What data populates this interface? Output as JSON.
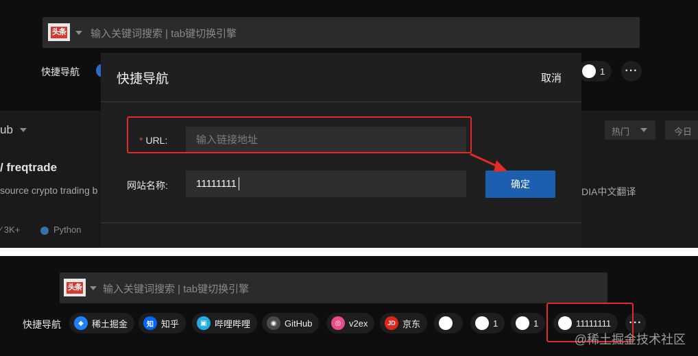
{
  "search": {
    "engine_logo": "头条",
    "placeholder": "输入关键词搜索 | tab键切换引擎"
  },
  "quick_nav": {
    "label": "快捷导航",
    "top_partial_count": "1",
    "items": [
      {
        "label": "稀土掘金",
        "icon": "juejin-icon",
        "color": "#1e80ff",
        "glyph": "◆"
      },
      {
        "label": "知乎",
        "icon": "zhihu-icon",
        "color": "#0066ff",
        "glyph": "知"
      },
      {
        "label": "哔哩哔哩",
        "icon": "bilibili-icon",
        "color": "#23ade5",
        "glyph": "▣"
      },
      {
        "label": "GitHub",
        "icon": "github-icon",
        "color": "#333333",
        "glyph": "◉"
      },
      {
        "label": "v2ex",
        "icon": "v2ex-icon",
        "color": "#ea4c89",
        "glyph": "◎"
      },
      {
        "label": "京东",
        "icon": "jd-icon",
        "color": "#e1251b",
        "glyph": "JD"
      },
      {
        "label": "",
        "icon": "blank-site-icon",
        "color": "#ffffff",
        "glyph": ""
      },
      {
        "label": "1",
        "icon": "blank-site-icon",
        "color": "#ffffff",
        "glyph": ""
      },
      {
        "label": "1",
        "icon": "blank-site-icon",
        "color": "#ffffff",
        "glyph": ""
      },
      {
        "label": "11111111",
        "icon": "blank-site-icon",
        "color": "#ffffff",
        "glyph": ""
      }
    ],
    "more": "···"
  },
  "background": {
    "section_title": "ub",
    "repo_title": "/ freqtrade",
    "repo_desc": "source crypto trading b",
    "stars": "3K+",
    "language": "Python",
    "language_color": "#3572a5",
    "hot_label": "热门",
    "today_label": "今日",
    "right_text": "DIA中文翻译"
  },
  "modal": {
    "title": "快捷导航",
    "cancel": "取消",
    "url_label": "URL:",
    "url_placeholder": "输入链接地址",
    "name_label": "网站名称:",
    "name_value": "11111111",
    "confirm": "确定"
  },
  "watermark": "@稀土掘金技术社区",
  "colors": {
    "highlight": "#e12b2b",
    "primary_button": "#1b5fae"
  }
}
